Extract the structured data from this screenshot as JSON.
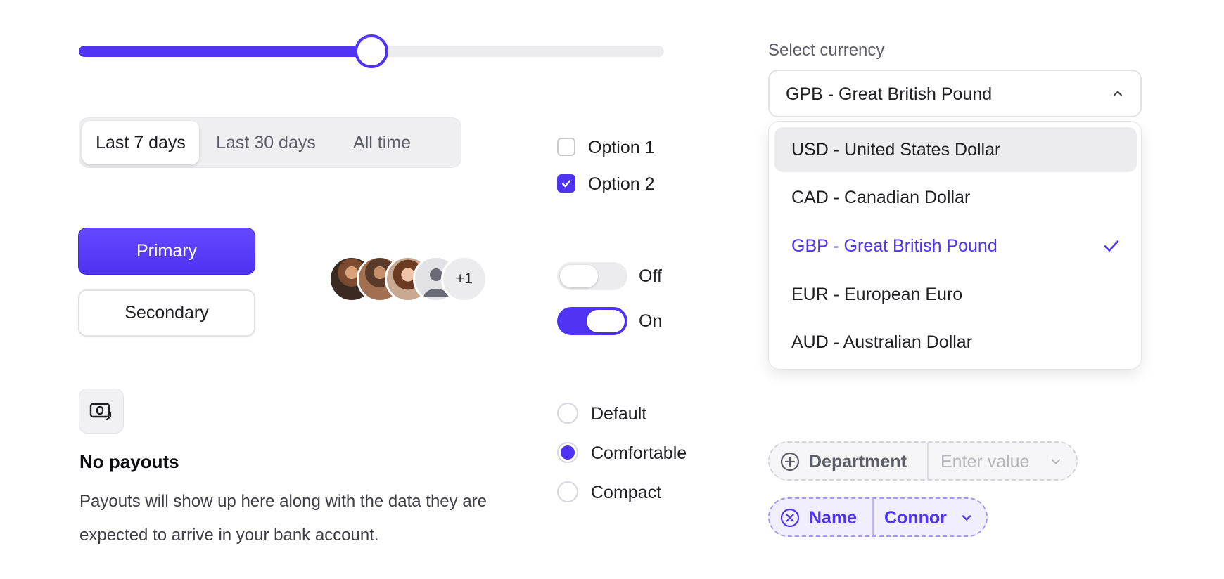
{
  "slider": {
    "value_fraction": 0.5,
    "accent": "#4f35f3"
  },
  "segmented": {
    "options": [
      "Last 7 days",
      "Last 30 days",
      "All time"
    ],
    "selected": "Last 7 days"
  },
  "buttons": {
    "primary_label": "Primary",
    "secondary_label": "Secondary"
  },
  "avatar_group": {
    "overflow_label": "+1"
  },
  "checkboxes": [
    {
      "label": "Option 1",
      "checked": false
    },
    {
      "label": "Option 2",
      "checked": true
    }
  ],
  "toggles": [
    {
      "label": "Off",
      "on": false
    },
    {
      "label": "On",
      "on": true
    }
  ],
  "radios": {
    "options": [
      "Default",
      "Comfortable",
      "Compact"
    ],
    "selected": "Comfortable"
  },
  "empty_state": {
    "icon": "cash-icon",
    "title": "No payouts",
    "description": "Payouts will show up here along with the data they are expected to arrive in your bank account."
  },
  "currency_select": {
    "label": "Select currency",
    "value": "GPB - Great British Pound",
    "options": [
      "USD - United States Dollar",
      "CAD - Canadian Dollar",
      "GBP - Great British Pound",
      "EUR - European Euro",
      "AUD - Australian Dollar"
    ],
    "selected_option": "GBP - Great British Pound",
    "hovered_option": "USD - United States Dollar"
  },
  "filters": {
    "department": {
      "label": "Department",
      "placeholder": "Enter value"
    },
    "name": {
      "label": "Name",
      "value": "Connor"
    }
  },
  "colors": {
    "accent": "#4f35f3",
    "muted_text": "#5d5d69",
    "chip_accent": "#f1eeff"
  }
}
